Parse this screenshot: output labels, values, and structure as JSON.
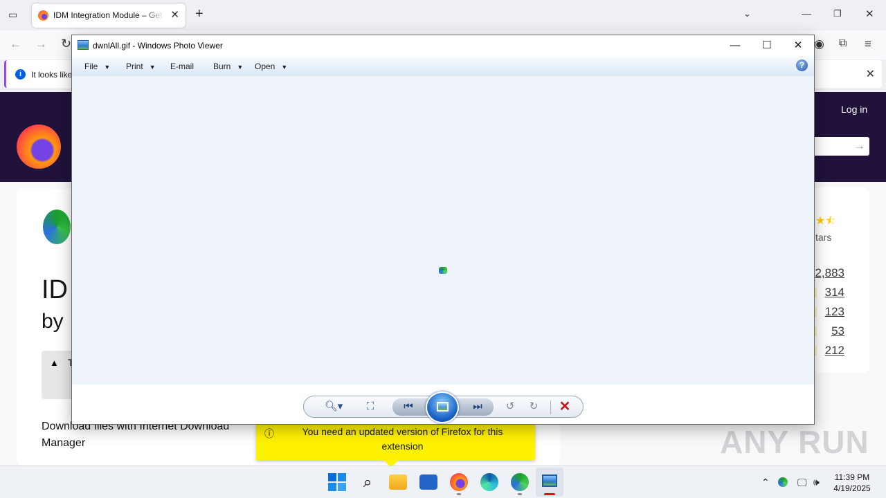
{
  "browser": {
    "tab_title": "IDM Integration Module – Get this Extension for Firefox (en-US)",
    "infobar_message": "It looks like",
    "login_label": "Log in",
    "page_title": "ID",
    "page_by": "by",
    "warning_prefix": "T",
    "description": "Download files with Internet Download Manager",
    "rating_label": "tars",
    "rating_counts": [
      "2,883",
      "314",
      "123",
      "53",
      "212"
    ],
    "popup_message": "You need an updated version of Firefox for this extension"
  },
  "photo_viewer": {
    "window_title": "dwnlAll.gif - Windows Photo Viewer",
    "menu": {
      "file": "File",
      "print": "Print",
      "email": "E-mail",
      "burn": "Burn",
      "open": "Open"
    },
    "help_label": "?"
  },
  "watermark": "ANY RUN",
  "taskbar": {
    "time": "11:39 PM",
    "date": "4/19/2025"
  },
  "colors": {
    "amo_header": "#20123a",
    "popup": "#fff200",
    "viewer_bg": "#eef3fa"
  }
}
